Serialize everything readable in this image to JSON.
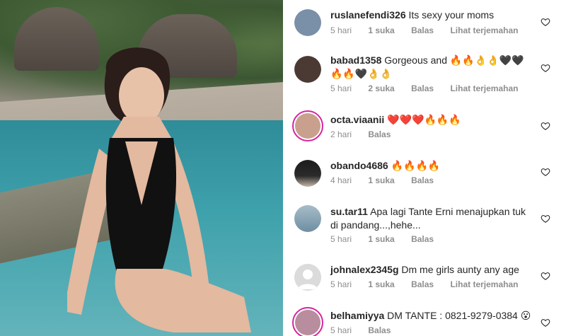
{
  "photo": {
    "description_icon": "photo-icon"
  },
  "comments": [
    {
      "username": "ruslanefendi326",
      "text": "Its sexy your moms",
      "time": "5 hari",
      "likes": "1 suka",
      "reply": "Balas",
      "translate": "Lihat terjemahan",
      "avatar_color": "#7a8fa8"
    },
    {
      "username": "babad1358",
      "text": "Gorgeous and 🔥🔥👌👌🖤🖤🔥🔥🖤👌👌",
      "time": "5 hari",
      "likes": "2 suka",
      "reply": "Balas",
      "translate": "Lihat terjemahan",
      "avatar_color": "#4b3a33"
    },
    {
      "username": "octa.viaanii",
      "text": "❤️❤️❤️🔥🔥🔥",
      "time": "2 hari",
      "likes": "",
      "reply": "Balas",
      "translate": "",
      "avatar_color": "#c9a08e"
    },
    {
      "username": "obando4686",
      "text": "🔥🔥🔥🔥",
      "time": "4 hari",
      "likes": "1 suka",
      "reply": "Balas",
      "translate": "",
      "avatar_color": "#2b2b2b"
    },
    {
      "username": "su.tar11",
      "text": "Apa lagi Tante Erni menajupkan tuk di pandang...,hehe...",
      "time": "5 hari",
      "likes": "1 suka",
      "reply": "Balas",
      "translate": "",
      "avatar_color": "#8fa6b7"
    },
    {
      "username": "johnalex2345g",
      "text": "Dm me girls aunty any age",
      "time": "5 hari",
      "likes": "1 suka",
      "reply": "Balas",
      "translate": "Lihat terjemahan",
      "avatar_color": "#d9d9d9"
    },
    {
      "username": "belhamiyya",
      "text": "DM TANTE : 0821-9279-0384 😮",
      "time": "5 hari",
      "likes": "",
      "reply": "Balas",
      "translate": "",
      "avatar_color": "#b88d9d"
    }
  ]
}
